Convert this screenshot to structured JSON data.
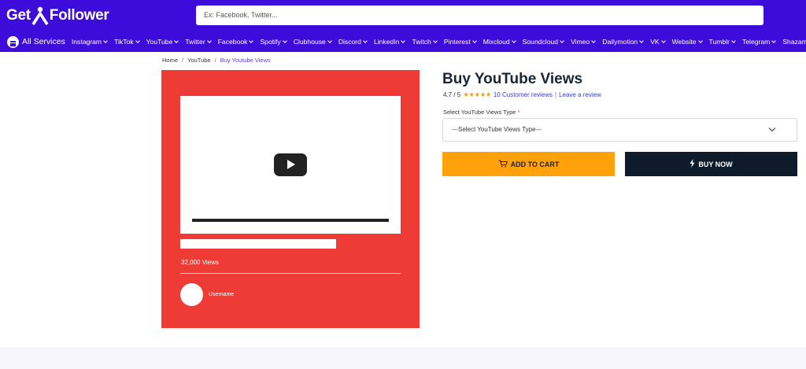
{
  "header": {
    "logo_part1": "Get",
    "logo_part2": "Follower",
    "search_placeholder": "Ex: Facebook, Twitter..."
  },
  "nav": {
    "all_services": "All Services",
    "items": [
      "Instagram",
      "TikTok",
      "YouTube",
      "Twitter",
      "Facebook",
      "Spotify",
      "Clubhouse",
      "Discord",
      "LinkedIn",
      "Twitch",
      "Pinterest",
      "Mixcloud",
      "Soundcloud",
      "Vimeo",
      "Dailymotion",
      "VK",
      "Website",
      "Tumblr",
      "Telegram",
      "Shazam"
    ]
  },
  "breadcrumb": {
    "home": "Home",
    "category": "YouTube",
    "current": "Buy Youtube Views",
    "separator": "/"
  },
  "product_image": {
    "views": "32,000 Views",
    "username": "Username"
  },
  "product": {
    "title": "Buy YouTube Views",
    "rating": "4.7 / 5",
    "stars": "★★★★★",
    "reviews_link": "10 Customer reviews",
    "separator": "|",
    "leave_review": "Leave a review",
    "select_label": "Select YouTube Views Type",
    "required_mark": "*",
    "select_placeholder": "---Select YouTube Views Type---",
    "add_to_cart": "ADD TO CART",
    "buy_now": "BUY NOW"
  },
  "colors": {
    "brand": "#3d0cdb",
    "image_bg": "#ef3b36",
    "cart_button": "#ffa10a",
    "buy_button": "#0d1b2a"
  }
}
